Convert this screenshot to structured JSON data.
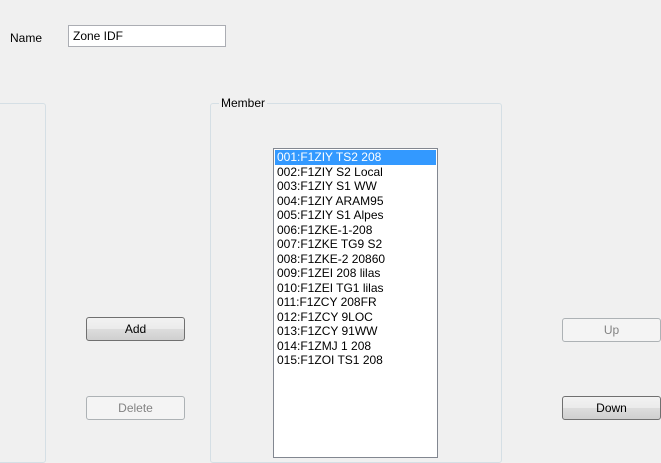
{
  "form": {
    "name_label": "Name",
    "name_value": "Zone IDF"
  },
  "member": {
    "group_label": "Member",
    "selected_index": 0,
    "items": [
      "001:F1ZIY TS2 208",
      "002:F1ZIY S2 Local",
      "003:F1ZIY S1 WW",
      "004:F1ZIY ARAM95",
      "005:F1ZIY S1 Alpes",
      "006:F1ZKE-1-208",
      "007:F1ZKE TG9 S2",
      "008:F1ZKE-2 20860",
      "009:F1ZEI 208 lilas",
      "010:F1ZEI TG1 lilas",
      "011:F1ZCY 208FR",
      "012:F1ZCY 9LOC",
      "013:F1ZCY 91WW",
      "014:F1ZMJ 1 208",
      "015:F1ZOI TS1 208"
    ]
  },
  "buttons": {
    "add_label": "Add",
    "delete_label": "Delete",
    "up_label": "Up",
    "down_label": "Down"
  },
  "colors": {
    "selection": "#3399ff",
    "window_bg": "#f0f0f0"
  }
}
